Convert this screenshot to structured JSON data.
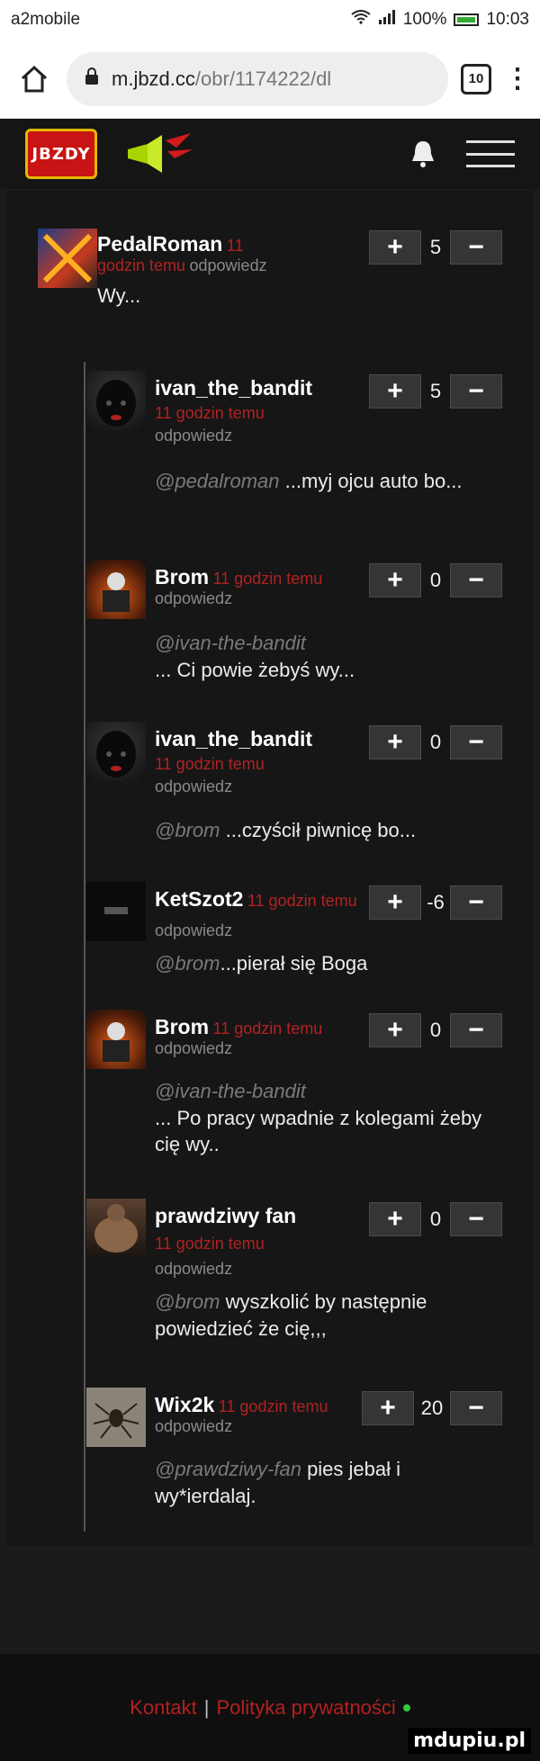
{
  "status_bar": {
    "carrier": "a2mobile",
    "battery": "100%",
    "time": "10:03"
  },
  "browser": {
    "url_host": "m.jbzd.cc",
    "url_path": "/obr/1174222/dl",
    "tab_count": "10"
  },
  "site": {
    "logo_text": "JBZDY"
  },
  "comments": [
    {
      "user": "PedalRoman",
      "time": "11 godzin temu",
      "reply": "odpowiedz",
      "mention": "",
      "text": "Wy...",
      "score": "5"
    },
    {
      "user": "ivan_the_bandit",
      "time": "11 godzin temu",
      "reply": "odpowiedz",
      "mention": "@pedalroman",
      "text": "...myj ojcu auto bo...",
      "score": "5"
    },
    {
      "user": "Brom",
      "time": "11 godzin temu",
      "reply": "odpowiedz",
      "mention": "@ivan-the-bandit",
      "text": "... Ci powie żebyś wy...",
      "score": "0"
    },
    {
      "user": "ivan_the_bandit",
      "time": "11 godzin temu",
      "reply": "odpowiedz",
      "mention": "@brom",
      "text": "...czyścił piwnicę bo...",
      "score": "0"
    },
    {
      "user": "KetSzot2",
      "time": "11 godzin temu",
      "reply": "odpowiedz",
      "mention": "@brom",
      "text": "...pierał się Boga",
      "score": "-6"
    },
    {
      "user": "Brom",
      "time": "11 godzin temu",
      "reply": "odpowiedz",
      "mention": "@ivan-the-bandit",
      "text": "... Po pracy wpadnie z kolegami żeby cię wy..",
      "score": "0"
    },
    {
      "user": "prawdziwy fan",
      "time": "11 godzin temu",
      "reply": "odpowiedz",
      "mention": "@brom",
      "text": "wyszkolić by następnie powiedzieć że cię,,,",
      "score": "0"
    },
    {
      "user": "Wix2k",
      "time": "11 godzin temu",
      "reply": "odpowiedz",
      "mention": "@prawdziwy-fan",
      "text": "pies jebał i wy*ierdalaj.",
      "score": "20"
    }
  ],
  "vote": {
    "plus": "+",
    "minus": "−"
  },
  "footer": {
    "contact": "Kontakt",
    "separator": "|",
    "privacy": "Polityka prywatności"
  },
  "watermark": "mdupiu.pl"
}
